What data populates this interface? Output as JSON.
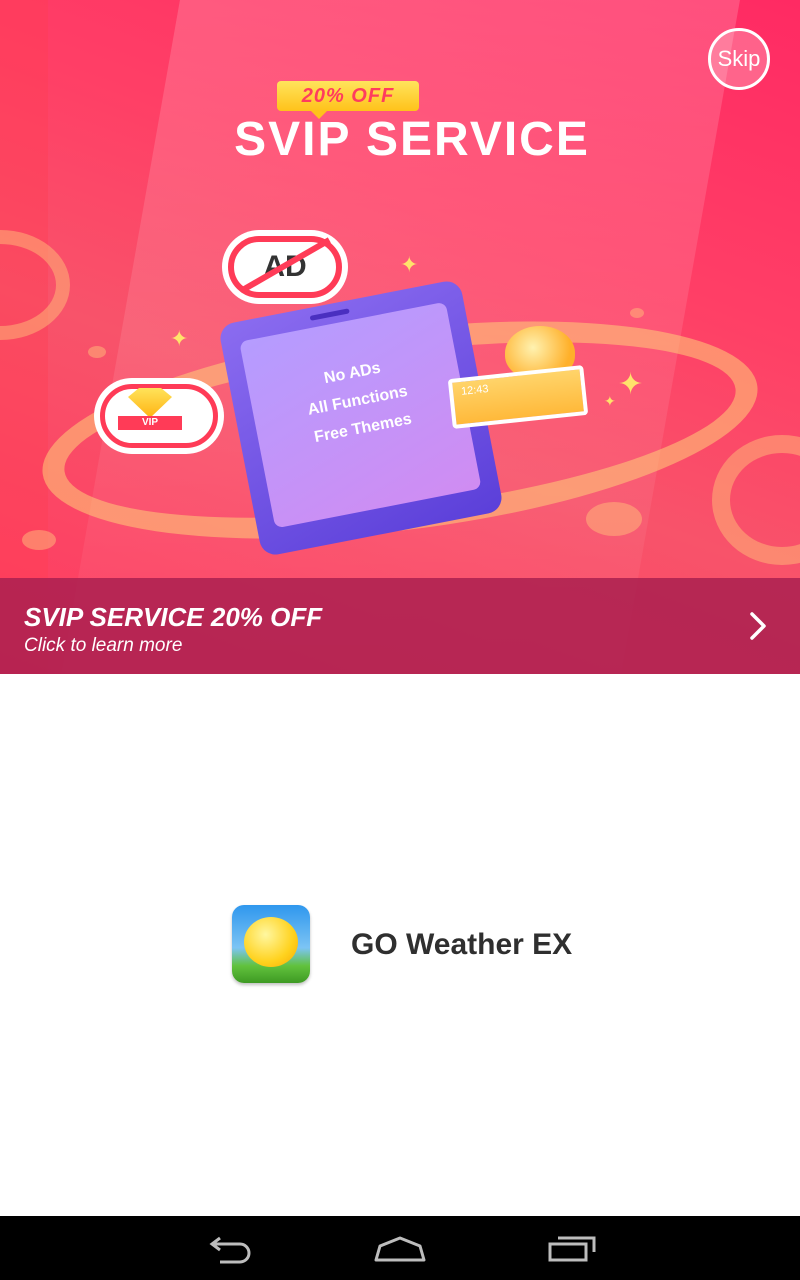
{
  "banner": {
    "discount_tag": "20% OFF",
    "headline": "SVIP SERVICE",
    "phone_lines": [
      "No ADs",
      "All Functions",
      "Free Themes"
    ],
    "ad_badge_text": "AD",
    "vip_badge_text": "VIP",
    "weather_card_time": "12:43",
    "skip_label": "Skip",
    "caption_title": "SVIP SERVICE 20% OFF",
    "caption_subtitle": "Click to learn more"
  },
  "app": {
    "name": "GO Weather EX",
    "icon": "go-weather-app-icon"
  },
  "navbar": {
    "back_icon": "back-icon",
    "home_icon": "home-icon",
    "recents_icon": "recents-icon"
  },
  "colors": {
    "banner_pink": "#ff2a63",
    "caption_overlay": "#aa2050",
    "navbar": "#000000"
  }
}
